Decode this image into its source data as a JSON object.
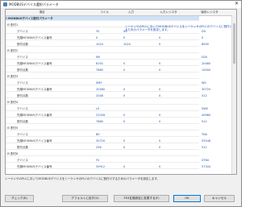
{
  "window": {
    "title": "MODBUSデバイス選択パラメータ"
  },
  "columns": [
    "項目",
    "コイル",
    "入力",
    "入力レジスタ",
    "保持レジスタ"
  ],
  "description": "シーケンサのPLCにおいてMODBUSデバイスをシーケンサのPLCのデバイスに割付けするためのパラメータを設定します。",
  "rows": [
    {
      "label": "MODBUSデバイス割付パラメータ",
      "kind": "section",
      "v": [
        "",
        "",
        "",
        ""
      ]
    },
    {
      "label": "割付1",
      "kind": "group",
      "v": [
        "",
        "",
        "",
        ""
      ]
    },
    {
      "label": "デバイス",
      "kind": "item",
      "v": [
        "Y0",
        "X0",
        "",
        "D0"
      ]
    },
    {
      "label": "先頭MODBUSデバイス番号",
      "kind": "item",
      "v": [
        "0",
        "0",
        "0",
        "0"
      ]
    },
    {
      "label": "割付点数",
      "kind": "item",
      "v": [
        "1024",
        "1024",
        "0",
        "8000"
      ]
    },
    {
      "label": "割付2",
      "kind": "group",
      "v": [
        "",
        "",
        "",
        ""
      ]
    },
    {
      "label": "デバイス",
      "kind": "item",
      "v": [
        "M0",
        "",
        "",
        "D20"
      ]
    },
    {
      "label": "先頭MODBUSデバイス番号",
      "kind": "item",
      "v": [
        "8192",
        "0",
        "0",
        "20480"
      ]
    },
    {
      "label": "割付点数",
      "kind": "item",
      "v": [
        "7680",
        "0",
        "0",
        "10000"
      ]
    },
    {
      "label": "割付3",
      "kind": "group",
      "v": [
        "",
        "",
        "",
        ""
      ]
    },
    {
      "label": "デバイス",
      "kind": "item",
      "v": [
        "SM0",
        "",
        "",
        "W0"
      ]
    },
    {
      "label": "先頭MODBUSデバイス番号",
      "kind": "item",
      "v": [
        "20480",
        "0",
        "0",
        "30720"
      ]
    },
    {
      "label": "割付点数",
      "kind": "item",
      "v": [
        "2048",
        "0",
        "0",
        "512"
      ]
    },
    {
      "label": "割付4",
      "kind": "group",
      "v": [
        "",
        "",
        "",
        ""
      ]
    },
    {
      "label": "デバイス",
      "kind": "item",
      "v": [
        "L0",
        "",
        "",
        "SW0"
      ]
    },
    {
      "label": "先頭MODBUSデバイス番号",
      "kind": "item",
      "v": [
        "22528",
        "0",
        "0",
        "40960"
      ]
    },
    {
      "label": "割付点数",
      "kind": "item",
      "v": [
        "7680",
        "0",
        "0",
        "512"
      ]
    },
    {
      "label": "割付5",
      "kind": "group",
      "v": [
        "",
        "",
        "",
        ""
      ]
    },
    {
      "label": "デバイス",
      "kind": "item",
      "v": [
        "B0",
        "",
        "",
        "TN0"
      ]
    },
    {
      "label": "先頭MODBUSデバイス番号",
      "kind": "item",
      "v": [
        "30720",
        "0",
        "0",
        "53248"
      ]
    },
    {
      "label": "割付点数",
      "kind": "item",
      "v": [
        "256",
        "0",
        "0",
        "512"
      ]
    },
    {
      "label": "割付6",
      "kind": "group",
      "v": [
        "",
        "",
        "",
        ""
      ]
    },
    {
      "label": "デバイス",
      "kind": "item",
      "v": [
        "F0",
        "",
        "",
        "STN0"
      ]
    },
    {
      "label": "先頭MODBUSデバイス番号",
      "kind": "item",
      "v": [
        "30912",
        "0",
        "0",
        "57344"
      ]
    }
  ],
  "footer_text": "シーケンサのPLCにおいてMODBUSデバイスをシーケンサのPLCのデバイスに割付けするためのパラメータを設定します。",
  "buttons": {
    "check": "チェック(K)",
    "default": "デフォルトに戻す(U)",
    "fx3_compat": "FX3互換設定に変更する(F)",
    "ok": "OK",
    "cancel": "キャンセル"
  }
}
